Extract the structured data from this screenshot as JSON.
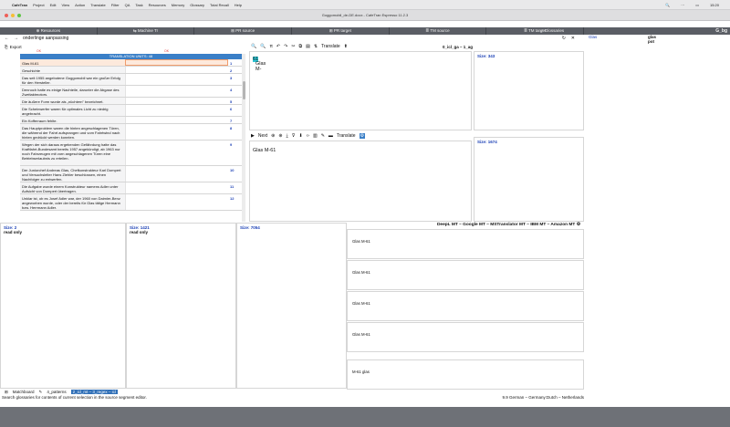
{
  "menubar": {
    "app": "CafeTran",
    "items": [
      "Project",
      "Edit",
      "View",
      "Action",
      "Translate",
      "Filter",
      "QA",
      "Task",
      "Resources",
      "Memory",
      "Glossary",
      "Total Recall",
      "Help"
    ],
    "time": "15:20"
  },
  "window": {
    "title": "Goggomobil_de-DE.docx - CafeTran Espresso 11.2.3"
  },
  "tabs": [
    "⊕ Resources",
    "⇆ Machine Tr",
    "⊞ PR source",
    "⊞ PR target",
    "≣ TM source",
    "≣ TM target"
  ],
  "glossaries_tab": "✓ Glossaries",
  "glossary_panel": {
    "code": "G_bg",
    "term": "Glas",
    "translations": [
      "glas",
      "pot"
    ]
  },
  "nav": {
    "title": "onderlinge aanpassing"
  },
  "export": {
    "label": "Export",
    "ok_left": "OK",
    "ok_right": "OK"
  },
  "translation_units": {
    "header": "TRANSLATION UNITS: 48"
  },
  "segments": [
    {
      "source": "Glas M-61",
      "num": "1",
      "h": 8
    },
    {
      "source": "Geschichte",
      "num": "2",
      "h": 8
    },
    {
      "source": "Das seit 1955 angebotene Goggomobil war ein großer Erfolg für den Hersteller.",
      "num": "3",
      "h": 13
    },
    {
      "source": "Dennoch hatte es einige Nachteile, darunter die Abgase des Zweitaktmotors.",
      "num": "4",
      "h": 13
    },
    {
      "source": "Die äußere Form wurde als „nüchtern\" bezeichnet.",
      "num": "5",
      "h": 8
    },
    {
      "source": "Die Scheinwerfer waren für optimales Licht zu niedrig angebracht.",
      "num": "6",
      "h": 13
    },
    {
      "source": "Ein Kofferraum fehlte.",
      "num": "7",
      "h": 8
    },
    {
      "source": "Das Hauptproblem waren die hinten angeschlagenen Türen, die während der Fahrt aufsprangen und vom Fahrtwind nach hinten gedrückt werden konnten.",
      "num": "8",
      "h": 18
    },
    {
      "source": "Wegen der sich daraus ergebenden Gefährdung hatte das Kraftfahrt-Bundesamt bereits 1957 angekündigt, ab 1963 nur noch Fahrzeugen mit vorn angeschlagenen Türen eine Betriebserlaubnis zu erteilen.",
      "num": "9",
      "h": 28
    },
    {
      "source": "Der Juniorchef Andreas Glas, Chefkonstrukteur Karl Dompert und Versuchsleiter Hans Ziehler beschlossen, einen Nachfolger zu entwerfen.",
      "num": "10",
      "h": 18
    },
    {
      "source": "Die Aufgabe wurde einem Konstrukteur namens Adler unter Aufsicht von Dompert übertragen.",
      "num": "11",
      "h": 13
    },
    {
      "source": "Unklar ist, ob es Josef Adler war, der 1960 von Daimler-Benz angeworben wurde, oder der bereits für Glas tätige Hermann bzw. Herrmann Adler.",
      "num": "12",
      "h": 18
    }
  ],
  "editor": {
    "source_text": "Glas M-",
    "source_highlight": "61",
    "translate_label": "Translate",
    "project_code": "0_icl_ga – 1_ag",
    "target_text": "Glas M-61",
    "next_label": "Next",
    "target_translate": "Translate"
  },
  "size_panels": {
    "src": "Size: 343",
    "tgt": "Size: 1674"
  },
  "lower_panels": [
    {
      "size": "Size: 2",
      "sub": "read only"
    },
    {
      "size": "Size: 1421",
      "sub": "read only"
    },
    {
      "size": "Size: 7054",
      "sub": ""
    }
  ],
  "mt": {
    "header": "DeepL MT – Google MT – MSTranslator MT – IBM MT – Amazon MT",
    "results": [
      "Glas M-61",
      "Glas M-61",
      "Glas M-61",
      "Glas M-61",
      "M-61 glas"
    ]
  },
  "bottom_tabs": {
    "matchboard": "Matchboard",
    "patterns": "4_patterns",
    "active": "2_icl_mt – 3_regex – icl"
  },
  "status": {
    "message": "Search glossaries for contents of current selection in the source segment editor.",
    "right": "9.9    German – Germany:Dutch – Netherlands"
  },
  "colors": {
    "accent": "#3a7fc7",
    "highlight": "#2ec4d3",
    "current_segment": "#fde9dc",
    "ok": "#e13a3a"
  }
}
